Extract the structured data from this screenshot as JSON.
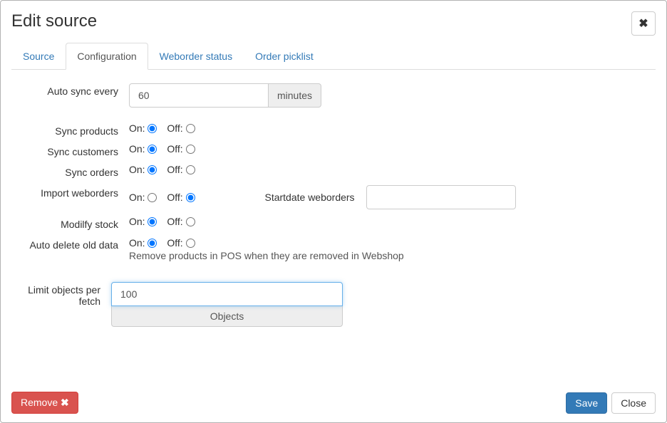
{
  "modal_title": "Edit source",
  "tabs": [
    {
      "label": "Source"
    },
    {
      "label": "Configuration"
    },
    {
      "label": "Weborder status"
    },
    {
      "label": "Order picklist"
    }
  ],
  "labels": {
    "auto_sync": "Auto sync every",
    "minutes": "minutes",
    "sync_products": "Sync products",
    "sync_customers": "Sync customers",
    "sync_orders": "Sync orders",
    "import_weborders": "Import weborders",
    "startdate_weborders": "Startdate weborders",
    "modify_stock": "Modilfy stock",
    "auto_delete": "Auto delete old data",
    "auto_delete_help": "Remove products in POS when they are removed in Webshop",
    "limit_objects": "Limit objects per fetch",
    "objects_addon": "Objects",
    "on": "On:",
    "off": "Off:"
  },
  "values": {
    "auto_sync": "60",
    "startdate_weborders": "",
    "limit_objects": "100"
  },
  "radios": {
    "sync_products": "on",
    "sync_customers": "on",
    "sync_orders": "on",
    "import_weborders": "off",
    "modify_stock": "on",
    "auto_delete": "on"
  },
  "footer": {
    "remove": "Remove",
    "save": "Save",
    "close": "Close"
  }
}
